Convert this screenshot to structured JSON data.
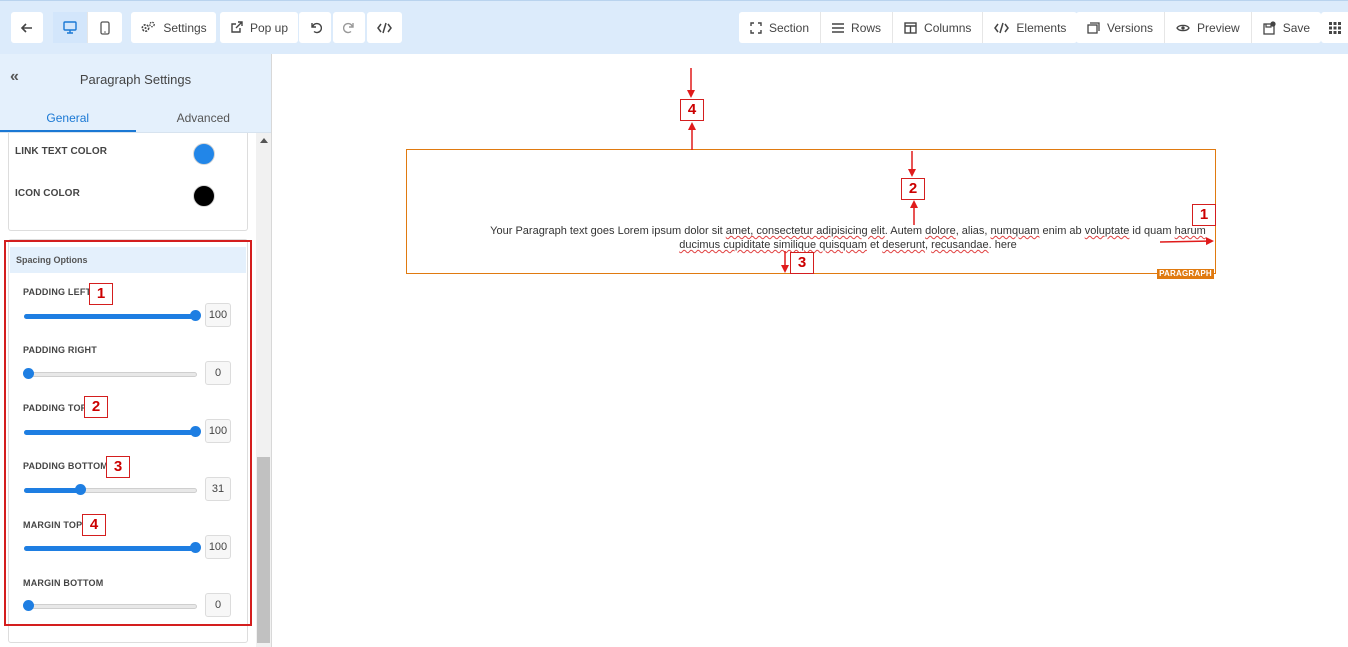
{
  "toolbar": {
    "settings_label": "Settings",
    "popup_label": "Pop up",
    "section_label": "Section",
    "rows_label": "Rows",
    "columns_label": "Columns",
    "elements_label": "Elements",
    "versions_label": "Versions",
    "preview_label": "Preview",
    "save_label": "Save"
  },
  "sidebar": {
    "title": "Paragraph Settings",
    "tabs": [
      {
        "label": "General",
        "active": true
      },
      {
        "label": "Advanced",
        "active": false
      }
    ],
    "colors": [
      {
        "label": "LINK TEXT COLOR",
        "value": "#2286e8"
      },
      {
        "label": "ICON COLOR",
        "value": "#000000"
      }
    ],
    "spacing": {
      "title": "Spacing Options",
      "controls": [
        {
          "label": "PADDING LEFT",
          "value": "100",
          "annotation": "1"
        },
        {
          "label": "PADDING RIGHT",
          "value": "0",
          "annotation": ""
        },
        {
          "label": "PADDING TOP",
          "value": "100",
          "annotation": "2"
        },
        {
          "label": "PADDING BOTTOM",
          "value": "31",
          "annotation": "3"
        },
        {
          "label": "MARGIN TOP",
          "value": "100",
          "annotation": "4"
        },
        {
          "label": "MARGIN BOTTOM",
          "value": "0",
          "annotation": ""
        }
      ]
    }
  },
  "canvas": {
    "paragraph_plain_1": "Your Paragraph text goes Lorem ipsum dolor sit ",
    "paragraph_sq_1": "amet, consectetur adipisicing elit",
    "paragraph_plain_2": ". Autem ",
    "paragraph_sq_2": "dolore",
    "paragraph_plain_3": ", alias, ",
    "paragraph_sq_3": "numquam",
    "paragraph_plain_4": " enim ab ",
    "paragraph_sq_4": "voluptate",
    "paragraph_plain_5": " id quam ",
    "paragraph_sq_5": "harum ducimus cupiditate similique quisquam",
    "paragraph_plain_6": " et ",
    "paragraph_sq_6": "deserunt",
    "paragraph_plain_7": ", ",
    "paragraph_sq_7": "recusandae",
    "paragraph_plain_8": ". here",
    "tag_label": "PARAGRAPH",
    "annotations": [
      "1",
      "2",
      "3",
      "4"
    ]
  },
  "colors": {
    "accent": "#1e7ee2",
    "element_border": "#e07a10",
    "annotation": "#d41e1e"
  }
}
